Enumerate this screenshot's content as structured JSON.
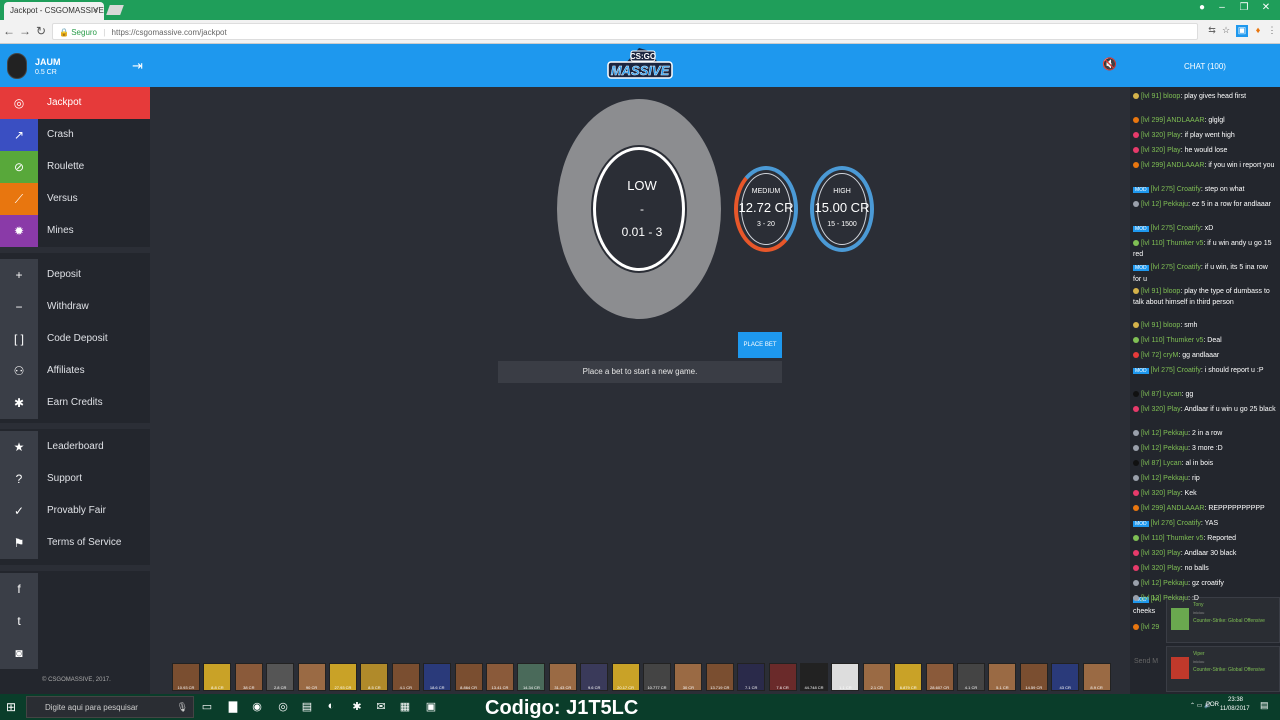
{
  "browser": {
    "tab_title": "Jackpot - CSGOMASSIVE",
    "tab_close": "×",
    "secure_label": "Seguro",
    "url": "https://csgomassive.com/jackpot",
    "minimize": "–",
    "maximize": "❐",
    "close": "✕"
  },
  "user": {
    "name": "JAUM",
    "balance": "0.5 CR"
  },
  "chat_title": "CHAT (100)",
  "nav": [
    {
      "label": "Jackpot",
      "icon": "jackpot-icon"
    },
    {
      "label": "Crash",
      "icon": "chart-icon"
    },
    {
      "label": "Roulette",
      "icon": "compass-icon"
    },
    {
      "label": "Versus",
      "icon": "sword-icon"
    },
    {
      "label": "Mines",
      "icon": "explosion-icon"
    },
    {
      "label": "Deposit",
      "icon": "plus-icon"
    },
    {
      "label": "Withdraw",
      "icon": "minus-icon"
    },
    {
      "label": "Code Deposit",
      "icon": "bracket-icon"
    },
    {
      "label": "Affiliates",
      "icon": "user-plus-icon"
    },
    {
      "label": "Earn Credits",
      "icon": "star-box-icon"
    },
    {
      "label": "Leaderboard",
      "icon": "star-icon"
    },
    {
      "label": "Support",
      "icon": "question-icon"
    },
    {
      "label": "Provably Fair",
      "icon": "check-icon"
    },
    {
      "label": "Terms of Service",
      "icon": "flag-icon"
    }
  ],
  "social": [
    "facebook-icon",
    "twitter-icon",
    "discord-icon"
  ],
  "copyright": "© CSGOMASSIVE, 2017.",
  "jackpot": {
    "low": {
      "title": "LOW",
      "dash": "-",
      "range": "0.01 - 3"
    },
    "medium": {
      "title": "MEDIUM",
      "amount": "12.72 CR",
      "range": "3 - 20"
    },
    "high": {
      "title": "HIGH",
      "amount": "15.00 CR",
      "range": "15 - 1500"
    },
    "place_bet": "PLACE BET",
    "status": "Place a bet to start a new game."
  },
  "chat": [
    {
      "user": "[lvl 91] bloop",
      "text": "play gives head first",
      "color": "#d4b24a"
    },
    {
      "user": "[lvl 299] ANDLAAAR",
      "text": "glglgl",
      "color": "#e8760f"
    },
    {
      "user": "[lvl 320] Play",
      "text": "if play went high",
      "color": "#e63a6a"
    },
    {
      "user": "[lvl 320] Play",
      "text": "he would lose",
      "color": "#e63a6a"
    },
    {
      "user": "[lvl 299] ANDLAAAR",
      "text": "if you win i report you",
      "color": "#e8760f"
    },
    {
      "user": "[lvl 275] Croatify",
      "text": "step on what",
      "mod": true
    },
    {
      "user": "[lvl 12] Pekkaju",
      "text": "ez 5 in a row for andlaaar",
      "color": "#9aa0ab"
    },
    {
      "user": "[lvl 275] Croatify",
      "text": "xD",
      "mod": true
    },
    {
      "user": "[lvl 110] Thumker v5",
      "text": "if u win andy u go 15 red",
      "color": "#7fbf54"
    },
    {
      "user": "[lvl 275] Croatify",
      "text": "if u win, its 5 ina row for u",
      "mod": true
    },
    {
      "user": "[lvl 91] bloop",
      "text": "play the type of dumbass to talk about himself in third person",
      "color": "#d4b24a"
    },
    {
      "user": "[lvl 91] bloop",
      "text": "smh",
      "color": "#d4b24a"
    },
    {
      "user": "[lvl 110] Thumker v5",
      "text": "Deal",
      "color": "#7fbf54"
    },
    {
      "user": "[lvl 72] cryM",
      "text": "gg andlaaar",
      "color": "#e63a3a"
    },
    {
      "user": "[lvl 275] Croatify",
      "text": "i should report u :P",
      "mod": true
    },
    {
      "user": "[lvl 87] Lycan",
      "text": "gg",
      "color": "#111"
    },
    {
      "user": "[lvl 320] Play",
      "text": "Andlaar if u win u go 25 black",
      "color": "#e63a6a"
    },
    {
      "user": "[lvl 12] Pekkaju",
      "text": "2 in a row",
      "color": "#9aa0ab"
    },
    {
      "user": "[lvl 12] Pekkaju",
      "text": "3 more :D",
      "color": "#9aa0ab"
    },
    {
      "user": "[lvl 87] Lycan",
      "text": "al in bois",
      "color": "#111"
    },
    {
      "user": "[lvl 12] Pekkaju",
      "text": "rip",
      "color": "#9aa0ab"
    },
    {
      "user": "[lvl 320] Play",
      "text": "Kek",
      "color": "#e63a6a"
    },
    {
      "user": "[lvl 299] ANDLAAAR",
      "text": "REPPPPPPPPPP",
      "color": "#e8760f"
    },
    {
      "user": "[lvl 276] Croatify",
      "text": "YAS",
      "mod": true
    },
    {
      "user": "[lvl 110] Thumker v5",
      "text": "Reported",
      "color": "#7fbf54"
    },
    {
      "user": "[lvl 320] Play",
      "text": "Andlaar 30 black",
      "color": "#e63a6a"
    },
    {
      "user": "[lvl 320] Play",
      "text": "no balls",
      "color": "#e63a6a"
    },
    {
      "user": "[lvl 12] Pekkaju",
      "text": "gz croatify",
      "color": "#9aa0ab"
    },
    {
      "user": "[lvl 12] Pekkaju",
      "text": ":D",
      "color": "#9aa0ab"
    }
  ],
  "chat_partial": {
    "prefix": "[lvl",
    "text": "cheeks"
  },
  "chat_partial2": {
    "prefix": "[lvl 29"
  },
  "chat_send_placeholder": "Send M",
  "notifications": [
    {
      "name": "Tony",
      "sub": "iniciou",
      "game": "Counter-Strike: Global Offensive"
    },
    {
      "name": "Viper",
      "sub": "iniciou",
      "game": "Counter-Strike: Global Offensive"
    }
  ],
  "recent_winners": [
    "10.93 CR",
    "8.8 CR",
    "38 CR",
    "2.8 CR",
    "90 CR",
    "27.93 CR",
    "8.5 CR",
    "4.1 CR",
    "18.6 CR",
    "8.864 CR",
    "13.41 CR",
    "14.34 CR",
    "31.43 CR",
    "9.6 CR",
    "20.17 CR",
    "10.777 CR",
    "30 CR",
    "13.719 CR",
    "7.1 CR",
    "7.6 CR",
    "44.748 CR",
    "1.1 CR",
    "2.1 CR",
    "6.879 CR",
    "28.607 CR",
    "4.1 CR",
    "5.1 CR",
    "14.59 CR",
    "43 CR",
    "8.9 CR"
  ],
  "taskbar": {
    "search_placeholder": "Digite aqui para pesquisar",
    "codigo": "Codigo: J1T5LC",
    "lang": "POR",
    "time": "23:38",
    "date": "11/08/2017"
  }
}
